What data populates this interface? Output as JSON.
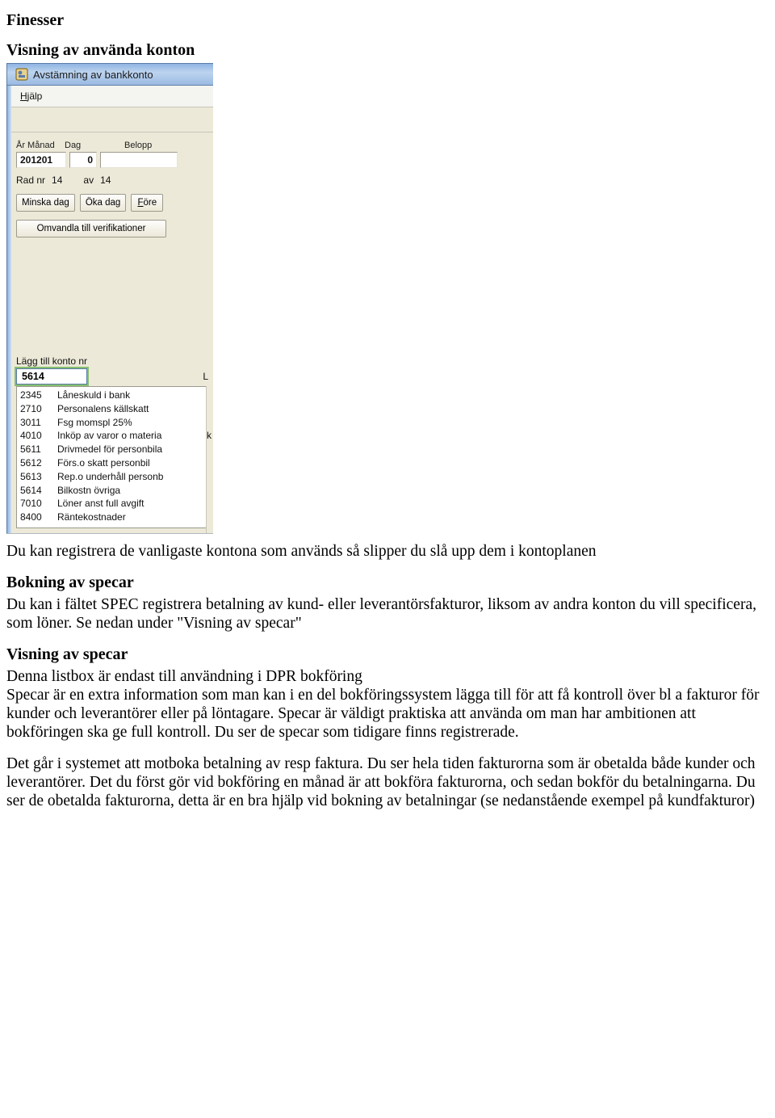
{
  "doc": {
    "h1": "Finesser",
    "sub1": "Visning av använda konton",
    "p1": "Du kan registrera de vanligaste kontona som används så slipper du slå upp dem i kontoplanen",
    "sub2": "Bokning av specar",
    "p2": "Du kan i fältet SPEC registrera betalning av kund- eller leverantörsfakturor, liksom av andra konton du vill specificera, som löner. Se nedan under \"Visning av specar\"",
    "sub3": "Visning av specar",
    "p3a": "Denna listbox är endast till användning i DPR bokföring",
    "p3b": "Specar är en extra information som man kan i en del bokföringssystem lägga till för att få kontroll över bl a fakturor för kunder och leverantörer eller på löntagare. Specar är väldigt praktiska att använda om man har ambitionen att bokföringen ska ge full kontroll. Du ser de specar som tidigare finns registrerade.",
    "p4": "Det går i systemet att motboka betalning av resp faktura. Du ser hela tiden fakturorna som är obetalda både kunder och  leverantörer. Det du först gör vid bokföring en månad är att bokföra fakturorna, och sedan bokför du betalningarna. Du ser de obetalda fakturorna, detta är en bra hjälp vid bokning av betalningar (se nedanstående exempel på kundfakturor)"
  },
  "app": {
    "title": "Avstämning av bankkonto",
    "menu": {
      "hjalp_h": "H",
      "hjalp_rest": "jälp"
    },
    "labels": {
      "arManad": "År Månad",
      "dag": "Dag",
      "belopp": "Belopp"
    },
    "values": {
      "arManad": "201201",
      "dag": "0",
      "belopp": ""
    },
    "rowNr": {
      "pre": "Rad nr",
      "n": "14",
      "mid": "av",
      "total": "14"
    },
    "buttons": {
      "minska": "Minska dag",
      "oka": "Öka dag",
      "fore_f": "F",
      "fore_rest": "öre",
      "omvandla": "Omvandla till verifikationer"
    },
    "laggTill": {
      "label": "Lägg till konto nr",
      "value": "5614",
      "rightStubA": "L",
      "rightStubB": "k"
    },
    "accounts": [
      {
        "code": "2345",
        "name": "Låneskuld i bank"
      },
      {
        "code": "2710",
        "name": "Personalens källskatt"
      },
      {
        "code": "3011",
        "name": "Fsg momspl 25%"
      },
      {
        "code": "4010",
        "name": "Inköp av varor o materia"
      },
      {
        "code": "5611",
        "name": "Drivmedel för personbila"
      },
      {
        "code": "5612",
        "name": "Förs.o skatt personbil"
      },
      {
        "code": "5613",
        "name": "Rep.o underhåll personb"
      },
      {
        "code": "5614",
        "name": "Bilkostn övriga"
      },
      {
        "code": "7010",
        "name": "Löner anst full avgift"
      },
      {
        "code": "8400",
        "name": "Räntekostnader"
      }
    ]
  }
}
